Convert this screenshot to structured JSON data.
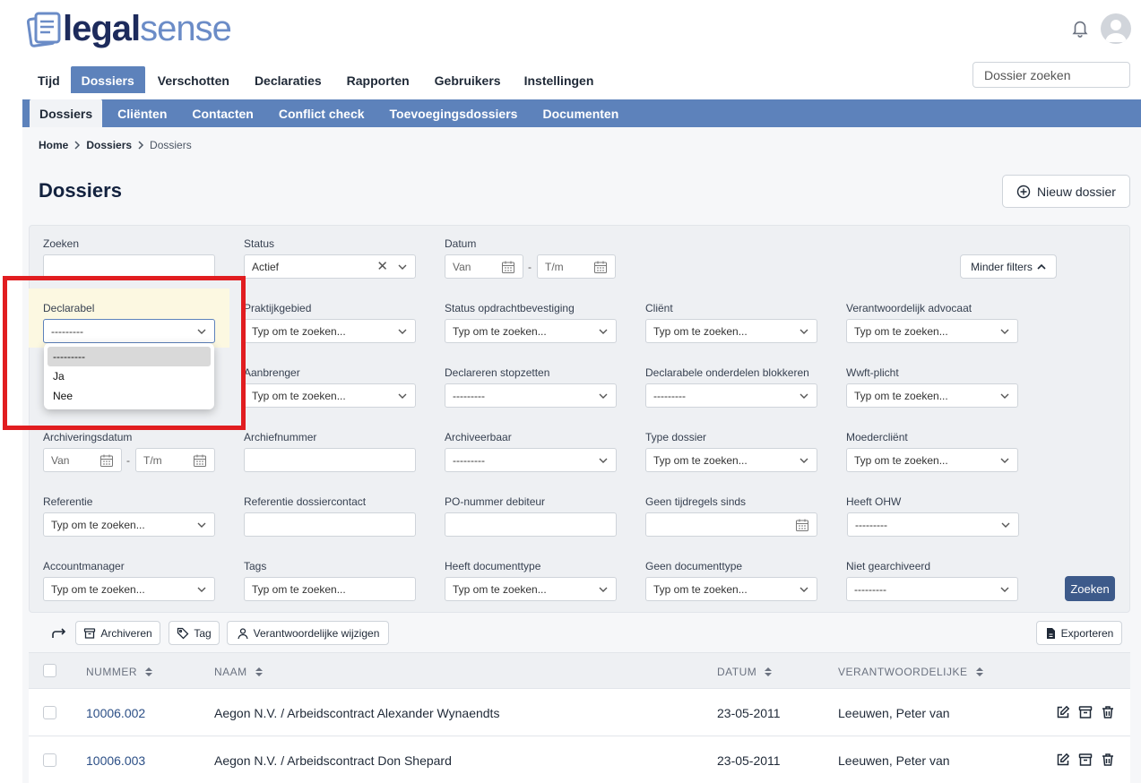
{
  "brand": {
    "logo_part1": "legal",
    "logo_part2": "sense"
  },
  "header": {
    "search_placeholder": "Dossier zoeken"
  },
  "top_nav": [
    "Tijd",
    "Dossiers",
    "Verschotten",
    "Declaraties",
    "Rapporten",
    "Gebruikers",
    "Instellingen"
  ],
  "sub_nav": [
    "Dossiers",
    "Cliënten",
    "Contacten",
    "Conflict check",
    "Toevoegingsdossiers",
    "Documenten"
  ],
  "breadcrumb": [
    "Home",
    "Dossiers",
    "Dossiers"
  ],
  "page_title": "Dossiers",
  "new_button": "Nieuw dossier",
  "filters": {
    "zoeken": {
      "label": "Zoeken",
      "value": ""
    },
    "status": {
      "label": "Status",
      "value": "Actief"
    },
    "datum": {
      "label": "Datum",
      "from": "Van",
      "to": "T/m"
    },
    "minder_filters": "Minder filters",
    "declarabel": {
      "label": "Declarabel",
      "value": "---------"
    },
    "praktijkgebied": {
      "label": "Praktijkgebied",
      "value": "Typ om te zoeken..."
    },
    "status_opdracht": {
      "label": "Status opdrachtbevestiging",
      "value": "Typ om te zoeken..."
    },
    "client": {
      "label": "Cliënt",
      "value": "Typ om te zoeken..."
    },
    "verantwoordelijk_advocaat": {
      "label": "Verantwoordelijk advocaat",
      "value": "Typ om te zoeken..."
    },
    "aanbrenger": {
      "label": "Aanbrenger",
      "value": "Typ om te zoeken..."
    },
    "declareren_stopzetten": {
      "label": "Declareren stopzetten",
      "value": "---------"
    },
    "declarabele_blokkeren": {
      "label": "Declarabele onderdelen blokkeren",
      "value": "---------"
    },
    "wwft": {
      "label": "Wwft-plicht",
      "value": "Typ om te zoeken..."
    },
    "archiveringsdatum": {
      "label": "Archiveringsdatum",
      "from": "Van",
      "to": "T/m"
    },
    "archiefnummer": {
      "label": "Archiefnummer",
      "value": ""
    },
    "archiveerbaar": {
      "label": "Archiveerbaar",
      "value": "---------"
    },
    "type_dossier": {
      "label": "Type dossier",
      "value": "Typ om te zoeken..."
    },
    "moederclient": {
      "label": "Moedercliënt",
      "value": "Typ om te zoeken..."
    },
    "referentie": {
      "label": "Referentie",
      "value": "Typ om te zoeken..."
    },
    "referentie_dossiercontact": {
      "label": "Referentie dossiercontact",
      "value": ""
    },
    "po_nummer": {
      "label": "PO-nummer debiteur",
      "value": ""
    },
    "geen_tijdregels": {
      "label": "Geen tijdregels sinds",
      "value": ""
    },
    "heeft_ohw": {
      "label": "Heeft OHW",
      "value": "---------"
    },
    "accountmanager": {
      "label": "Accountmanager",
      "value": "Typ om te zoeken..."
    },
    "tags": {
      "label": "Tags",
      "value": "Typ om te zoeken..."
    },
    "heeft_documenttype": {
      "label": "Heeft documenttype",
      "value": "Typ om te zoeken..."
    },
    "geen_documenttype": {
      "label": "Geen documenttype",
      "value": "Typ om te zoeken..."
    },
    "niet_gearchiveerd": {
      "label": "Niet gearchiveerd",
      "value": "---------"
    },
    "zoeken_button": "Zoeken"
  },
  "declarabel_dropdown": [
    "---------",
    "Ja",
    "Nee"
  ],
  "actions": {
    "archiveren": "Archiveren",
    "tag": "Tag",
    "verantwoordelijke": "Verantwoordelijke wijzigen",
    "exporteren": "Exporteren"
  },
  "table": {
    "columns": [
      "NUMMER",
      "NAAM",
      "DATUM",
      "VERANTWOORDELIJKE"
    ],
    "rows": [
      {
        "nummer": "10006.002",
        "naam": "Aegon N.V. / Arbeidscontract Alexander Wynaendts",
        "datum": "23-05-2011",
        "verantwoordelijke": "Leeuwen, Peter van"
      },
      {
        "nummer": "10006.003",
        "naam": "Aegon N.V. / Arbeidscontract Don Shepard",
        "datum": "23-05-2011",
        "verantwoordelijke": "Leeuwen, Peter van"
      }
    ]
  }
}
